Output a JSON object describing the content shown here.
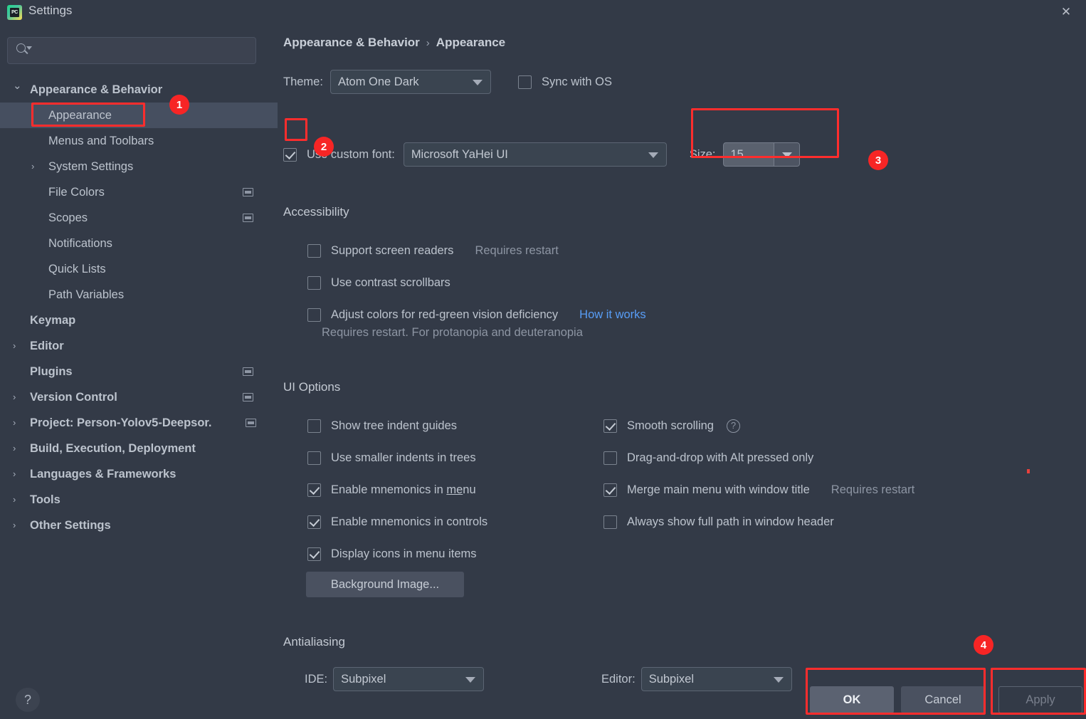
{
  "window": {
    "title": "Settings",
    "app_icon": "pycharm-logo",
    "close_label": "✕"
  },
  "sidebar": {
    "search": {
      "value": "",
      "placeholder": ""
    },
    "items": [
      {
        "label": "Appearance & Behavior",
        "level": 0,
        "chevron": "⌄",
        "expanded": true,
        "selected": false,
        "badge": false
      },
      {
        "label": "Appearance",
        "level": 1,
        "chevron": "",
        "expanded": false,
        "selected": true,
        "badge": false
      },
      {
        "label": "Menus and Toolbars",
        "level": 1,
        "chevron": "",
        "expanded": false,
        "selected": false,
        "badge": false
      },
      {
        "label": "System Settings",
        "level": 1,
        "chevron": "›",
        "expanded": false,
        "selected": false,
        "badge": false
      },
      {
        "label": "File Colors",
        "level": 1,
        "chevron": "",
        "expanded": false,
        "selected": false,
        "badge": true
      },
      {
        "label": "Scopes",
        "level": 1,
        "chevron": "",
        "expanded": false,
        "selected": false,
        "badge": true
      },
      {
        "label": "Notifications",
        "level": 1,
        "chevron": "",
        "expanded": false,
        "selected": false,
        "badge": false
      },
      {
        "label": "Quick Lists",
        "level": 1,
        "chevron": "",
        "expanded": false,
        "selected": false,
        "badge": false
      },
      {
        "label": "Path Variables",
        "level": 1,
        "chevron": "",
        "expanded": false,
        "selected": false,
        "badge": false
      },
      {
        "label": "Keymap",
        "level": 0,
        "chevron": "",
        "expanded": false,
        "selected": false,
        "badge": false
      },
      {
        "label": "Editor",
        "level": 0,
        "chevron": "›",
        "expanded": false,
        "selected": false,
        "badge": false
      },
      {
        "label": "Plugins",
        "level": 0,
        "chevron": "",
        "expanded": false,
        "selected": false,
        "badge": true
      },
      {
        "label": "Version Control",
        "level": 0,
        "chevron": "›",
        "expanded": false,
        "selected": false,
        "badge": true
      },
      {
        "label": "Project: Person-Yolov5-Deepsor.",
        "level": 0,
        "chevron": "›",
        "expanded": false,
        "selected": false,
        "badge": true
      },
      {
        "label": "Build, Execution, Deployment",
        "level": 0,
        "chevron": "›",
        "expanded": false,
        "selected": false,
        "badge": false
      },
      {
        "label": "Languages & Frameworks",
        "level": 0,
        "chevron": "›",
        "expanded": false,
        "selected": false,
        "badge": false
      },
      {
        "label": "Tools",
        "level": 0,
        "chevron": "›",
        "expanded": false,
        "selected": false,
        "badge": false
      },
      {
        "label": "Other Settings",
        "level": 0,
        "chevron": "›",
        "expanded": false,
        "selected": false,
        "badge": false
      }
    ],
    "help_label": "?"
  },
  "main": {
    "breadcrumb": {
      "parent": "Appearance & Behavior",
      "separator": "›",
      "current": "Appearance"
    },
    "theme": {
      "label": "Theme:",
      "value": "Atom One Dark",
      "sync_with_os_label": "Sync with OS",
      "sync_with_os_checked": false
    },
    "custom_font": {
      "checkbox_label": "Use custom font:",
      "checked": true,
      "font_value": "Microsoft YaHei UI",
      "size_label": "Size:",
      "size_value": "15"
    },
    "accessibility": {
      "title": "Accessibility",
      "options": [
        {
          "label": "Support screen readers",
          "checked": false,
          "note": "Requires restart",
          "link": ""
        },
        {
          "label": "Use contrast scrollbars",
          "checked": false,
          "note": "",
          "link": ""
        },
        {
          "label": "Adjust colors for red-green vision deficiency",
          "checked": false,
          "note": "",
          "link": "How it works"
        }
      ],
      "footnote": "Requires restart. For protanopia and deuteranopia"
    },
    "ui_options": {
      "title": "UI Options",
      "left": [
        {
          "label": "Show tree indent guides",
          "checked": false
        },
        {
          "label": "Use smaller indents in trees",
          "checked": false
        },
        {
          "label": "Enable mnemonics in menu",
          "checked": true,
          "mnemonic": "me"
        },
        {
          "label": "Enable mnemonics in controls",
          "checked": true
        },
        {
          "label": "Display icons in menu items",
          "checked": true
        }
      ],
      "right": [
        {
          "label": "Smooth scrolling",
          "checked": true,
          "help": true,
          "note": ""
        },
        {
          "label": "Drag-and-drop with Alt pressed only",
          "checked": false,
          "help": false,
          "note": ""
        },
        {
          "label": "Merge main menu with window title",
          "checked": true,
          "help": false,
          "note": "Requires restart"
        },
        {
          "label": "Always show full path in window header",
          "checked": false,
          "help": false,
          "note": ""
        }
      ],
      "background_image_button": "Background Image..."
    },
    "antialiasing": {
      "title": "Antialiasing",
      "ide_label": "IDE:",
      "ide_value": "Subpixel",
      "editor_label": "Editor:",
      "editor_value": "Subpixel"
    },
    "buttons": {
      "ok": "OK",
      "cancel": "Cancel",
      "apply": "Apply"
    }
  },
  "annotations": {
    "badges": [
      "1",
      "2",
      "3",
      "4"
    ],
    "accent_color": "#f72525"
  }
}
